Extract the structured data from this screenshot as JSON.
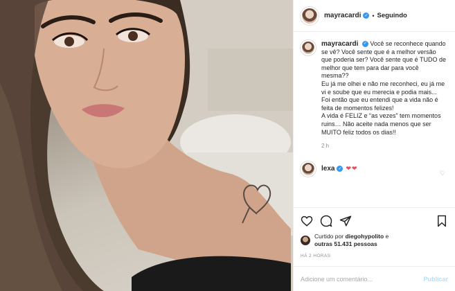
{
  "post": {
    "author": "mayracardi",
    "follow_separator": "•",
    "follow_status": "Seguindo",
    "caption_paragraphs": [
      "Você se reconhece quando se vê? Você sente que é a melhor versão que poderia ser? Você sente que é TUDO de melhor que tem para dar para você mesma??",
      "Eu já me olhei e não me reconheci, eu já me vi e soube que eu merecia e podia mais...",
      "Foi então que eu entendi que a vida não é feita de momentos felizes!",
      "A vida é FELIZ e “as vezes” tem momentos ruins… Não aceite nada menos que ser MUITO feliz todos os dias!!"
    ],
    "caption_time": "2 h"
  },
  "comments": [
    {
      "user": "lexa",
      "text": "❤❤"
    }
  ],
  "likes": {
    "prefix": "Curtido por",
    "user": "diegohypolito",
    "conjunction": "e",
    "others": "outras 51.431 pessoas"
  },
  "post_time": "HÁ 2 HORAS",
  "add_comment": {
    "placeholder": "Adicione um comentário...",
    "publish_label": "Publicar"
  },
  "icons": {
    "verified": "verified-badge-icon",
    "like": "heart-icon",
    "comment": "comment-icon",
    "share": "share-icon",
    "save": "bookmark-icon"
  },
  "colors": {
    "verified": "#3897f0",
    "publish_disabled": "#b2dffc",
    "heart": "#ed4956",
    "muted": "#8e8e8e"
  }
}
